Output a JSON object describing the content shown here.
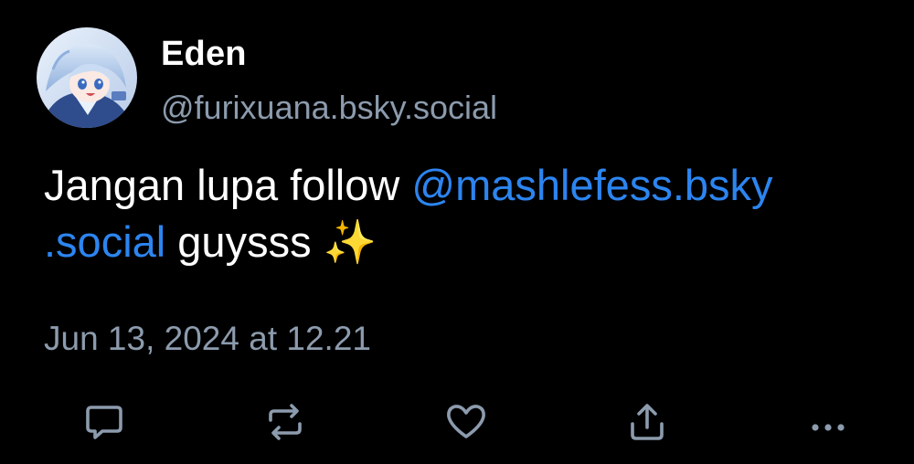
{
  "post": {
    "author": {
      "display_name": "Eden",
      "handle": "@furixuana.bsky.social"
    },
    "text": {
      "before_mention": "Jangan lupa follow ",
      "mention_line1": "@mashlefess.bsky",
      "mention_line2": ".social",
      "after_mention": " guysss ✨"
    },
    "timestamp": "Jun 13, 2024 at 12.21",
    "actions": {
      "reply_icon": "comment-bubble",
      "repost_icon": "repost-arrows",
      "like_icon": "heart",
      "share_icon": "share-upload",
      "more_icon": "ellipsis"
    }
  },
  "colors": {
    "background": "#000000",
    "text_primary": "#ffffff",
    "text_secondary": "#8c9bad",
    "link": "#2c85f0",
    "icon": "#8c9bad"
  }
}
